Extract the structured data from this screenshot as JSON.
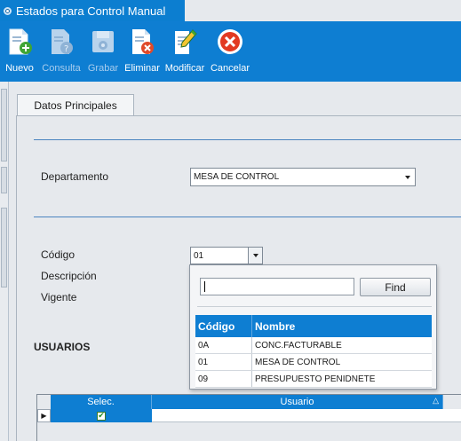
{
  "window": {
    "title": "Estados para Control Manual"
  },
  "toolbar": {
    "nuevo": "Nuevo",
    "consulta": "Consulta",
    "grabar": "Grabar",
    "eliminar": "Eliminar",
    "modificar": "Modificar",
    "cancelar": "Cancelar"
  },
  "tabs": {
    "datos_principales": "Datos Principales"
  },
  "form": {
    "departamento_label": "Departamento",
    "departamento_value": "MESA DE CONTROL",
    "codigo_label": "Código",
    "codigo_value": "01",
    "descripcion_label": "Descripción",
    "vigente_label": "Vigente",
    "usuarios_title": "USUARIOS"
  },
  "usuarios_grid": {
    "col_selec": "Selec.",
    "col_usuario": "Usuario",
    "rows": [
      {
        "selec": true,
        "usuario": ""
      }
    ]
  },
  "lookup": {
    "search_value": "",
    "find_label": "Find",
    "col_codigo": "Código",
    "col_nombre": "Nombre",
    "rows": [
      {
        "codigo": "0A",
        "nombre": "CONC.FACTURABLE"
      },
      {
        "codigo": "01",
        "nombre": "MESA DE CONTROL"
      },
      {
        "codigo": "09",
        "nombre": "PRESUPUESTO PENIDNETE"
      }
    ]
  },
  "colors": {
    "accent": "#0e7ed2",
    "background": "#e6e9ed",
    "divider": "#4a84bf"
  }
}
